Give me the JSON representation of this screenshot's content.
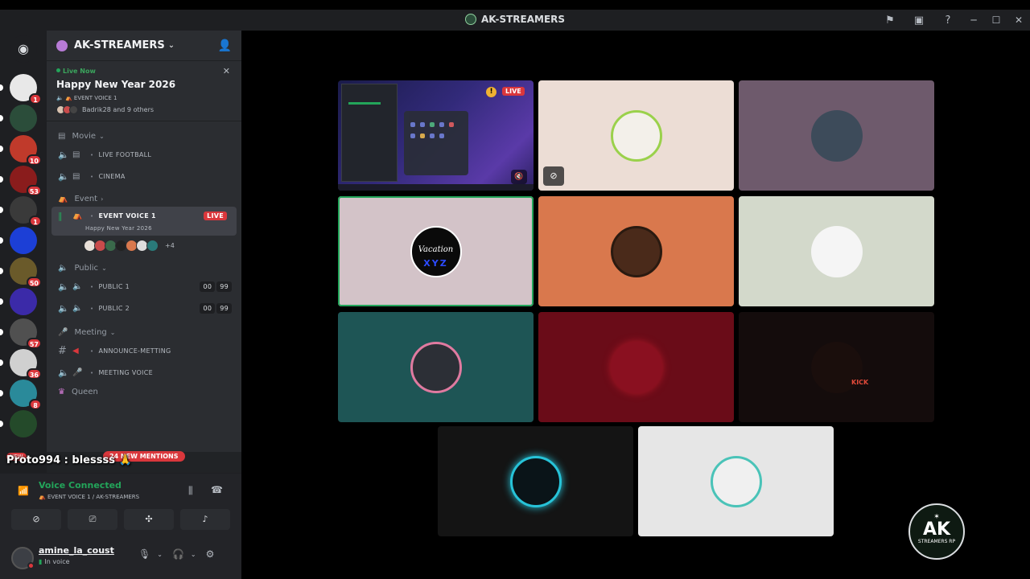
{
  "window": {
    "title": "AK-STREAMERS",
    "minimize": "─",
    "maximize": "☐",
    "close": "✕"
  },
  "rail": {
    "servers": [
      {
        "badge": "1",
        "color": "#e8e8e8"
      },
      {
        "badge": "",
        "color": "#2b4d3a"
      },
      {
        "badge": "10",
        "color": "#c03a2b"
      },
      {
        "badge": "53",
        "color": "#8a1c1c"
      },
      {
        "badge": "1",
        "color": "#3a3a3a"
      },
      {
        "badge": "",
        "color": "#1c3fd6"
      },
      {
        "badge": "50",
        "color": "#6a5a2a"
      },
      {
        "badge": "",
        "color": "#3b2aa8"
      },
      {
        "badge": "57",
        "color": "#505050"
      },
      {
        "badge": "36",
        "color": "#d0d0d0"
      },
      {
        "badge": "8",
        "color": "#2a8a9a"
      },
      {
        "badge": "",
        "color": "#244a2a"
      }
    ]
  },
  "sidebar": {
    "server_name": "AK-STREAMERS",
    "live_card": {
      "live_label": "Live Now",
      "title": "Happy New Year 2026",
      "channel": "EVENT VOICE 1",
      "people": "Badrik28 and 9 others"
    },
    "categories": {
      "movie": "Movie",
      "event": "Event",
      "public": "Public",
      "meeting": "Meeting",
      "queen": "Queen"
    },
    "channels": {
      "live_football": "LIVE FOOTBALL",
      "cinema": "CINEMA",
      "event_voice": "EVENT VOICE 1",
      "event_voice_sub": "Happy New Year 2026",
      "live_badge": "LIVE",
      "more_users": "+4",
      "public1": "PUBLIC 1",
      "public2": "PUBLIC 2",
      "limit_a": "00",
      "limit_b": "99",
      "announce": "ANNOUNCE-METTING",
      "meeting_voice": "MEETING VOICE"
    },
    "new_badge": "NEW",
    "new_mentions": "24 NEW MENTIONS",
    "chat_line": "Proto994 : blessss 🙏"
  },
  "voice_panel": {
    "title": "Voice Connected",
    "subtitle": "EVENT VOICE 1 / AK-STREAMERS"
  },
  "user_panel": {
    "username": "amine_la_coust",
    "status": "In voice"
  },
  "stage": {
    "screen_live": "LIVE",
    "warn": "!",
    "vacation_text": "Vacation",
    "xyz_text": "XYZ",
    "kick_text": "KICK",
    "logo_top": "✶",
    "logo_main": "AK",
    "logo_sub": "STREAMERS RP",
    "tile_colors": [
      "#1a1b4a",
      "#ecddd5",
      "#6e5a6c",
      "#d3c3c8",
      "#d9784d",
      "#d3d9cb",
      "#1e5555",
      "#6a0c18",
      "#140c0c",
      "#141414",
      "#e6e6e6"
    ]
  }
}
